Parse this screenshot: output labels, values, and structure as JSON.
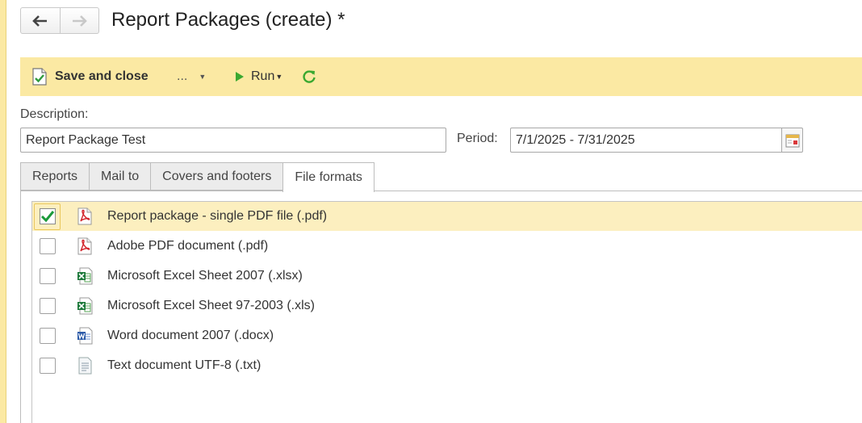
{
  "header": {
    "title": "Report Packages (create) *"
  },
  "toolbar": {
    "save_close_label": "Save and close",
    "more_label": "...",
    "run_label": "Run"
  },
  "form": {
    "description_label": "Description:",
    "description_value": "Report Package Test",
    "period_label": "Period:",
    "period_value": "7/1/2025 - 7/31/2025"
  },
  "tabs": [
    {
      "label": "Reports"
    },
    {
      "label": "Mail to"
    },
    {
      "label": "Covers and footers"
    },
    {
      "label": "File formats",
      "active": true
    }
  ],
  "file_formats": [
    {
      "label": "Report package - single PDF file (.pdf)",
      "checked": true,
      "icon": "pdf-icon"
    },
    {
      "label": "Adobe PDF document (.pdf)",
      "checked": false,
      "icon": "pdf-icon"
    },
    {
      "label": "Microsoft Excel Sheet 2007 (.xlsx)",
      "checked": false,
      "icon": "excel-icon"
    },
    {
      "label": "Microsoft Excel Sheet 97-2003 (.xls)",
      "checked": false,
      "icon": "excel-icon"
    },
    {
      "label": "Word document 2007 (.docx)",
      "checked": false,
      "icon": "word-icon"
    },
    {
      "label": "Text document UTF-8 (.txt)",
      "checked": false,
      "icon": "text-document-icon"
    }
  ],
  "colors": {
    "toolbar_bg": "#fbe9a3",
    "selected_row_bg": "#fcefbf",
    "check_green": "#1a9a3a",
    "run_green": "#3aa830"
  }
}
